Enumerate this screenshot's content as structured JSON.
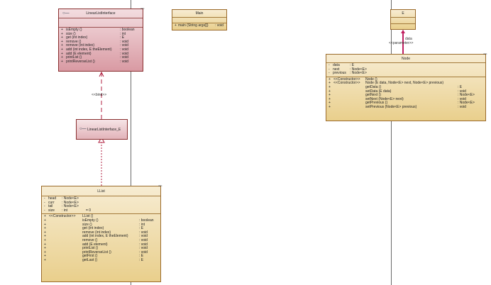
{
  "linear_list_interface": {
    "name": "LinearListInterface",
    "badge": "▫▫▫",
    "methods": [
      {
        "vis": "+",
        "sig": "isEmpty ()",
        "ret": ": boolean"
      },
      {
        "vis": "+",
        "sig": "size ()",
        "ret": ": int"
      },
      {
        "vis": "+",
        "sig": "get (int index)",
        "ret": ": E"
      },
      {
        "vis": "+",
        "sig": "remove ()",
        "ret": ": void"
      },
      {
        "vis": "+",
        "sig": "remove (int index)",
        "ret": ": void"
      },
      {
        "vis": "+",
        "sig": "add (int index, E theElement)",
        "ret": ": void"
      },
      {
        "vis": "+",
        "sig": "add (E element)",
        "ret": ": void"
      },
      {
        "vis": "+",
        "sig": "printList ()",
        "ret": ": void"
      },
      {
        "vis": "+",
        "sig": "printReverseList ()",
        "ret": ": void"
      }
    ]
  },
  "main_class": {
    "name": "Main",
    "methods": [
      {
        "vis": "+",
        "sig": "main (String args[])",
        "ret": ": void"
      }
    ]
  },
  "e_class": {
    "name": "E"
  },
  "node_class": {
    "name": "Node",
    "badge": "▫▫▫",
    "attributes": [
      {
        "vis": "-",
        "name": "data",
        "type": ": E"
      },
      {
        "vis": "-",
        "name": "next",
        "type": ": Node<E>"
      },
      {
        "vis": "-",
        "name": "previous",
        "type": ": Node<E>"
      }
    ],
    "methods": [
      {
        "vis": "+",
        "stereo": "<<Constructor>>",
        "sig": "Node ()",
        "ret": ""
      },
      {
        "vis": "+",
        "stereo": "<<Constructor>>",
        "sig": "Node (E data, Node<E> next, Node<E> previous)",
        "ret": ""
      },
      {
        "vis": "+",
        "stereo": "",
        "sig": "getData ()",
        "ret": ": E"
      },
      {
        "vis": "+",
        "stereo": "",
        "sig": "setData (E data)",
        "ret": ": void"
      },
      {
        "vis": "+",
        "stereo": "",
        "sig": "getNext ()",
        "ret": ": Node<E>"
      },
      {
        "vis": "+",
        "stereo": "",
        "sig": "setNext (Node<E> next)",
        "ret": ": void"
      },
      {
        "vis": "+",
        "stereo": "",
        "sig": "getPrevious ()",
        "ret": ": Node<E>"
      },
      {
        "vis": "+",
        "stereo": "",
        "sig": "setPrevious (Node<E> previous)",
        "ret": ": void"
      }
    ]
  },
  "bound_interface": {
    "name": "LinearListInterface_E"
  },
  "llist_class": {
    "name": "LList",
    "badge": "▫▫▫",
    "attributes": [
      {
        "vis": "-",
        "name": "head",
        "type": ": Node<E>",
        "init": ""
      },
      {
        "vis": "-",
        "name": "curr",
        "type": ": Node<E>",
        "init": ""
      },
      {
        "vis": "-",
        "name": "tail",
        "type": ": Node<E>",
        "init": ""
      },
      {
        "vis": "-",
        "name": "size",
        "type": ": int",
        "init": "= 0"
      }
    ],
    "methods": [
      {
        "vis": "+",
        "stereo": "<<Constructor>>",
        "sig": "LList ()",
        "ret": ""
      },
      {
        "vis": "+",
        "stereo": "",
        "sig": "isEmpty ()",
        "ret": ": boolean"
      },
      {
        "vis": "+",
        "stereo": "",
        "sig": "size ()",
        "ret": ": int"
      },
      {
        "vis": "+",
        "stereo": "",
        "sig": "get (int index)",
        "ret": ": E"
      },
      {
        "vis": "+",
        "stereo": "",
        "sig": "remove (int index)",
        "ret": ": void"
      },
      {
        "vis": "+",
        "stereo": "",
        "sig": "add (int index, E theElement)",
        "ret": ": void"
      },
      {
        "vis": "+",
        "stereo": "",
        "sig": "remove ()",
        "ret": ": void"
      },
      {
        "vis": "+",
        "stereo": "",
        "sig": "add (E element)",
        "ret": ": void"
      },
      {
        "vis": "+",
        "stereo": "",
        "sig": "printList ()",
        "ret": ": void"
      },
      {
        "vis": "+",
        "stereo": "",
        "sig": "printReverseList ()",
        "ret": ": void"
      },
      {
        "vis": "+",
        "stereo": "",
        "sig": "getFirst ()",
        "ret": ": E"
      },
      {
        "vis": "+",
        "stereo": "",
        "sig": "getLast ()",
        "ret": ": E"
      }
    ]
  },
  "connectors": {
    "bind_label": "<<bind>>",
    "data_role": "data",
    "data_stereo": "<<parameter>>"
  },
  "icons": {
    "interface_icon": "lollipop-icon",
    "view_icon": "element-view-icon"
  }
}
